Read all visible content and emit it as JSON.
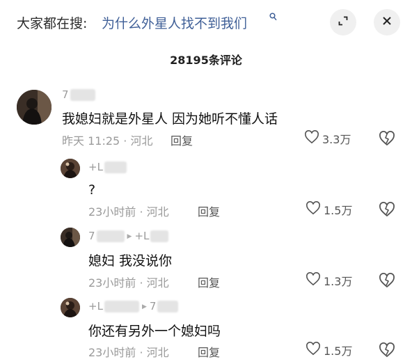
{
  "header": {
    "search_prefix": "大家都在搜:",
    "search_query": "为什么外星人找不到我们",
    "search_icon": "search-icon",
    "expand_icon": "expand-icon",
    "close_icon": "close-icon"
  },
  "comment_count": "28195条评论",
  "comments": [
    {
      "user": "7",
      "text": "我媳妇就是外星人 因为她听不懂人话",
      "time_location": "昨天 11:25 · 河北",
      "reply_label": "回复",
      "likes": "3.3万"
    }
  ],
  "replies": [
    {
      "user": "+L",
      "reply_to": "",
      "text": "?",
      "time_location": "23小时前 · 河北",
      "reply_label": "回复",
      "likes": "1.5万"
    },
    {
      "user": "7",
      "reply_to": "+L",
      "text": "媳妇 我没说你",
      "time_location": "23小时前 · 河北",
      "reply_label": "回复",
      "likes": "1.3万"
    },
    {
      "user": "+L",
      "reply_to": "7",
      "text": "你还有另外一个媳妇吗",
      "time_location": "23小时前 · 河北",
      "reply_label": "回复",
      "likes": "1.5万"
    }
  ],
  "colors": {
    "query": "#3f5f97",
    "meta": "#9a9a9a"
  }
}
